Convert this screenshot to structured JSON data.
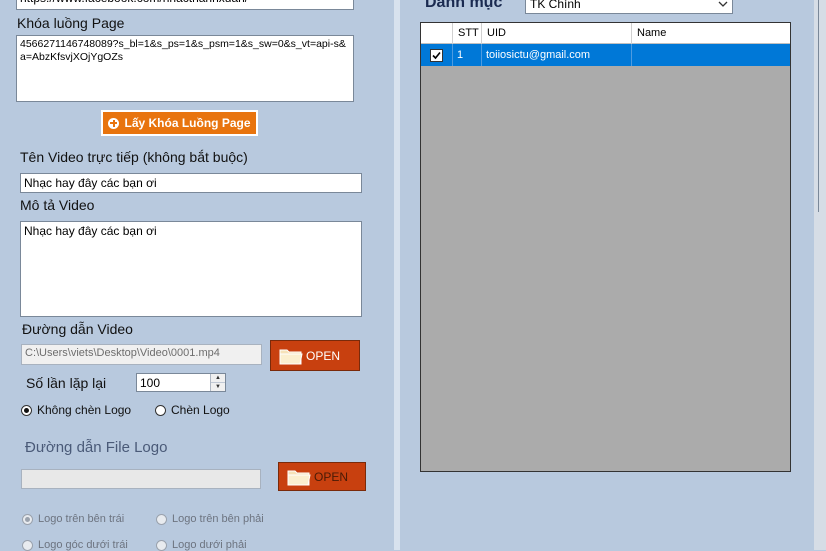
{
  "left": {
    "top_url": {
      "value": "https://www.facebook.com/nhacthanhxuan/"
    },
    "page_key": {
      "label": "Khóa luồng Page",
      "value": "4566271146748089?s_bl=1&s_ps=1&s_psm=1&s_sw=0&s_vt=api-s&a=AbzKfsvjXOjYgOZs"
    },
    "get_key_button": {
      "label": "Lấy Khóa Luồng Page",
      "icon": "plus-circle-icon"
    },
    "video_name": {
      "label": "Tên Video trực tiếp (không bắt buộc)",
      "value": "Nhạc hay đây các bạn ơi"
    },
    "description": {
      "label": "Mô tả Video",
      "value": "Nhạc hay đây các bạn ơi"
    },
    "video_path": {
      "label": "Đường dẫn Video",
      "value": "C:\\Users\\viets\\Desktop\\Video\\0001.mp4",
      "button": "OPEN",
      "icon": "folder-icon"
    },
    "repeat": {
      "label": "Số lần lặp lại",
      "value": "100"
    },
    "logo_mode": {
      "options": [
        {
          "label": "Không chèn Logo",
          "selected": true
        },
        {
          "label": "Chèn Logo",
          "selected": false
        }
      ]
    },
    "logo_path": {
      "label": "Đường dẫn File Logo",
      "value": "",
      "button": "OPEN",
      "icon": "folder-icon"
    },
    "logo_position": {
      "options": [
        {
          "label": "Logo trên bên trái",
          "selected": true
        },
        {
          "label": "Logo trên bên phải",
          "selected": false
        },
        {
          "label": "Logo góc dưới trái",
          "selected": false
        },
        {
          "label": "Logo dưới phải",
          "selected": false
        }
      ]
    }
  },
  "right": {
    "category": {
      "label": "Danh mục",
      "selected": "TK Chính"
    },
    "table": {
      "columns": [
        "STT",
        "UID",
        "Name"
      ],
      "rows": [
        {
          "checked": true,
          "stt": "1",
          "uid": "toiiosictu@gmail.com",
          "name": ""
        }
      ]
    }
  },
  "colors": {
    "background": "#b8c9de",
    "accent_orange": "#e8740e",
    "open_button": "#c8400f",
    "selection": "#0078d7",
    "grid_empty": "#ababab"
  }
}
